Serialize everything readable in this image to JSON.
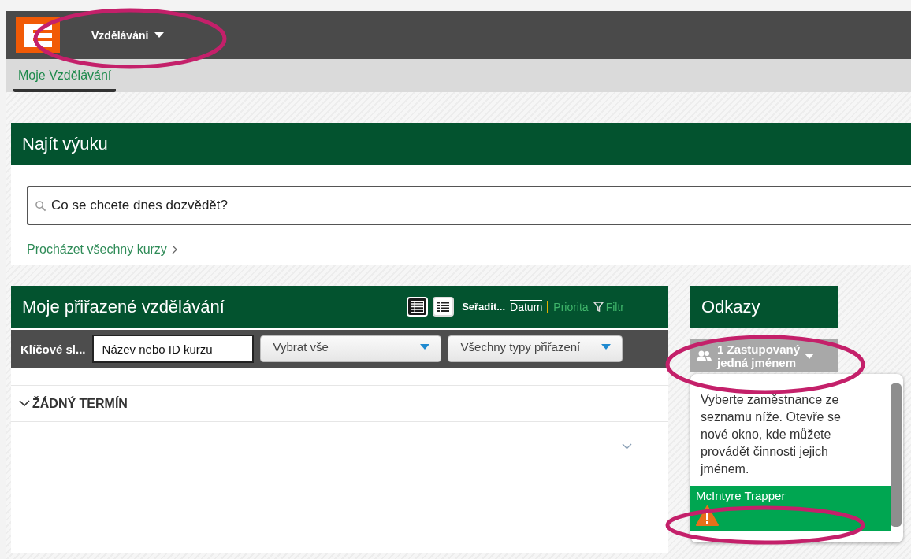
{
  "header": {
    "menu_label": "Vzdělávání"
  },
  "subnav": {
    "tabs": [
      {
        "label": "Moje Vzdělávání",
        "selected": true
      }
    ]
  },
  "find_card": {
    "title": "Najít výuku",
    "search": {
      "placeholder": "Co se chcete dnes dozvědět?"
    },
    "browse_link": "Procházet všechny kurzy"
  },
  "assigned_card": {
    "title": "Moje přiřazené vzdělávání",
    "views": [
      {
        "kind": "table",
        "selected": true
      },
      {
        "kind": "list",
        "selected": false
      }
    ],
    "sort_label": "Seřadit...",
    "sort_options": [
      {
        "label": "Datum",
        "selected": true
      },
      {
        "label": "Priorita",
        "selected": false
      }
    ],
    "filter_label": "Filtr",
    "keyword_label": "Klíčové sl...",
    "keyword_field": {
      "placeholder": "Název nebo ID kurzu"
    },
    "dropdowns": [
      "Vybrat vše",
      "Všechny typy přiřazení"
    ],
    "sections": [
      {
        "title": "ŽÁDNÝ TERMÍN",
        "expanded": true
      }
    ]
  },
  "links_card": {
    "title": "Odkazy",
    "proxy_button": {
      "label_lines": [
        "1 Zastupovaný",
        "jedná jménem"
      ],
      "expanded": true
    },
    "popup": {
      "text": "Vyberte zaměstnance ze seznamu níže. Otevře se nové okno, kde můžete provádět činnosti jejich jménem.",
      "items": [
        {
          "name": "McIntyre Trapper",
          "selected": true,
          "warning": true
        }
      ]
    }
  },
  "annotations": [
    {
      "kind": "ellipse"
    },
    {
      "kind": "ellipse"
    },
    {
      "kind": "ellipse"
    }
  ]
}
